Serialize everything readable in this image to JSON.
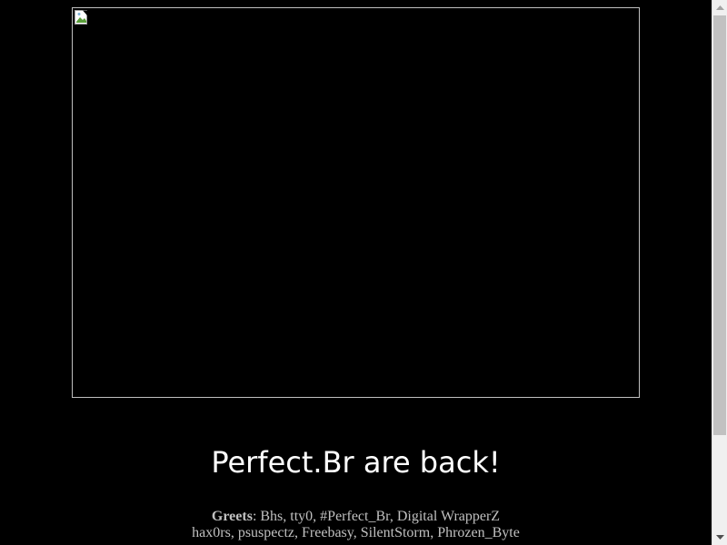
{
  "page": {
    "background_color": "#000000",
    "text_color": "#c0c0c0"
  },
  "main_image": {
    "state": "broken",
    "icon": "broken-image-icon"
  },
  "headline": {
    "text": "Perfect.Br are back!",
    "color": "#ffffff"
  },
  "greets": {
    "label": "Greets",
    "line1": ": Bhs, tty0, #Perfect_Br, Digital WrapperZ",
    "line2": "hax0rs, psuspectz, Freebasy, SilentStorm, Phrozen_Byte"
  },
  "scrollbar": {
    "up_icon": "scroll-up-arrow-icon",
    "down_icon": "scroll-down-arrow-icon",
    "position": 0
  }
}
